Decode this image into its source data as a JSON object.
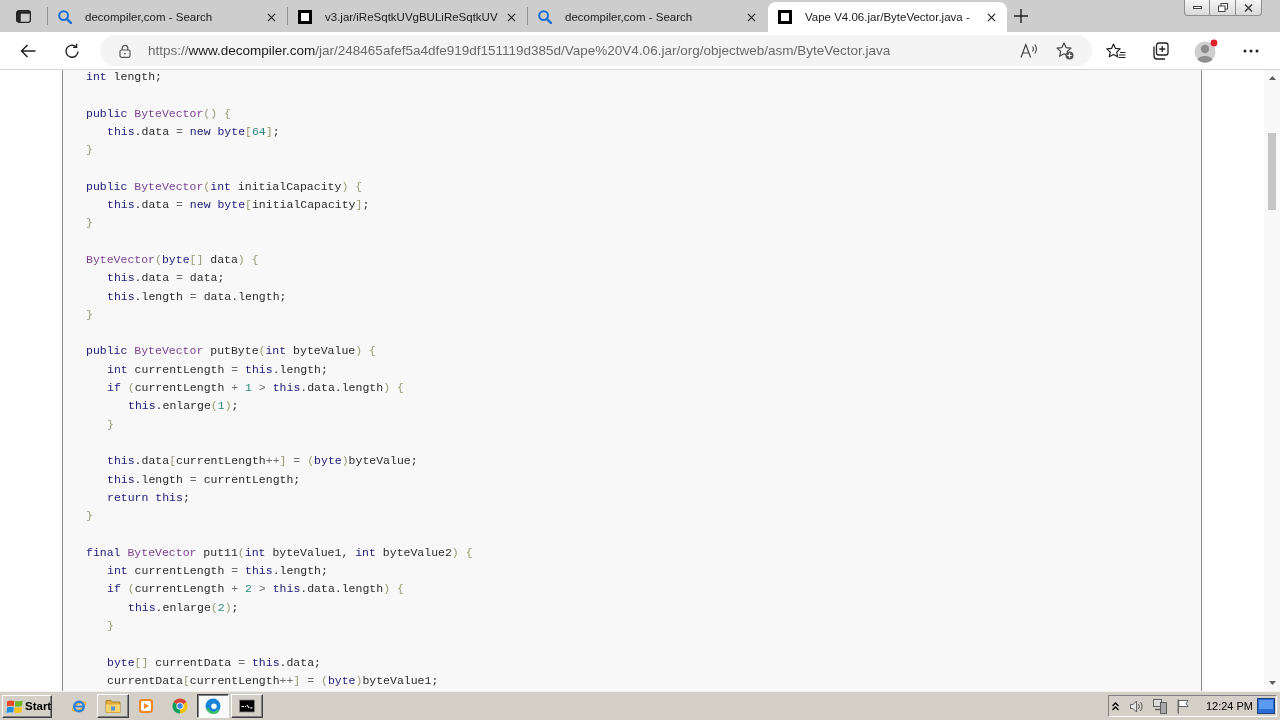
{
  "tabs": [
    {
      "title": "decompiler,com - Search",
      "kind": "search",
      "selected": false
    },
    {
      "title": "v3.jar/iReSqtkUVgBULiReSqtkUV",
      "kind": "page",
      "selected": false
    },
    {
      "title": "decompiler,com - Search",
      "kind": "search",
      "selected": false
    },
    {
      "title": "Vape V4.06.jar/ByteVector.java -",
      "kind": "page",
      "selected": true
    }
  ],
  "address_bar": {
    "scheme": "https://",
    "host": "www.decompiler.com",
    "path": "/jar/248465afef5a4dfe919df151119d385d/Vape%20V4.06.jar/org/objectweb/asm/ByteVector.java"
  },
  "code": {
    "lines": [
      {
        "kind": "code",
        "tokens": [
          {
            "kind": "keyword",
            "text": "int"
          },
          {
            "kind": "plain",
            "text": " length;"
          }
        ]
      },
      {
        "kind": "blank"
      },
      {
        "kind": "code",
        "tokens": [
          {
            "kind": "keyword",
            "text": "public "
          },
          {
            "kind": "type",
            "text": "ByteVector"
          },
          {
            "kind": "bracket",
            "text": "() {"
          }
        ],
        "children": [
          {
            "kind": "code",
            "tokens": [
              {
                "kind": "keyword",
                "text": "this"
              },
              {
                "kind": "plain",
                "text": ".data "
              },
              {
                "kind": "operator",
                "text": "="
              },
              {
                "kind": "keyword",
                "text": " new byte"
              },
              {
                "kind": "bracket",
                "text": "["
              },
              {
                "kind": "number",
                "text": "64"
              },
              {
                "kind": "bracket",
                "text": "]"
              },
              {
                "kind": "plain",
                "text": ";"
              }
            ]
          }
        ]
      },
      {
        "kind": "code",
        "tokens": [
          {
            "kind": "bracket",
            "text": "}"
          }
        ]
      },
      {
        "kind": "blank"
      },
      {
        "kind": "code",
        "tokens": [
          {
            "kind": "keyword",
            "text": "public "
          },
          {
            "kind": "type",
            "text": "ByteVector"
          },
          {
            "kind": "bracket",
            "text": "("
          },
          {
            "kind": "keyword",
            "text": "int"
          },
          {
            "kind": "plain",
            "text": " initialCapacity"
          },
          {
            "kind": "bracket",
            "text": ") {"
          }
        ],
        "children": [
          {
            "kind": "code",
            "tokens": [
              {
                "kind": "keyword",
                "text": "this"
              },
              {
                "kind": "plain",
                "text": ".data "
              },
              {
                "kind": "operator",
                "text": "="
              },
              {
                "kind": "keyword",
                "text": " new byte"
              },
              {
                "kind": "bracket",
                "text": "["
              },
              {
                "kind": "plain",
                "text": "initialCapacity"
              },
              {
                "kind": "bracket",
                "text": "]"
              },
              {
                "kind": "plain",
                "text": ";"
              }
            ]
          }
        ]
      },
      {
        "kind": "code",
        "tokens": [
          {
            "kind": "bracket",
            "text": "}"
          }
        ]
      },
      {
        "kind": "blank"
      },
      {
        "kind": "code",
        "tokens": [
          {
            "kind": "type",
            "text": "ByteVector"
          },
          {
            "kind": "bracket",
            "text": "("
          },
          {
            "kind": "keyword",
            "text": "byte"
          },
          {
            "kind": "bracket",
            "text": "[]"
          },
          {
            "kind": "plain",
            "text": " data"
          },
          {
            "kind": "bracket",
            "text": ") {"
          }
        ],
        "children": [
          {
            "kind": "code",
            "tokens": [
              {
                "kind": "keyword",
                "text": "this"
              },
              {
                "kind": "plain",
                "text": ".data "
              },
              {
                "kind": "operator",
                "text": "="
              },
              {
                "kind": "plain",
                "text": " data;"
              }
            ]
          },
          {
            "kind": "code",
            "tokens": [
              {
                "kind": "keyword",
                "text": "this"
              },
              {
                "kind": "plain",
                "text": ".length "
              },
              {
                "kind": "operator",
                "text": "="
              },
              {
                "kind": "plain",
                "text": " data.length;"
              }
            ]
          }
        ]
      },
      {
        "kind": "code",
        "tokens": [
          {
            "kind": "bracket",
            "text": "}"
          }
        ]
      },
      {
        "kind": "blank"
      },
      {
        "kind": "code",
        "tokens": [
          {
            "kind": "keyword",
            "text": "public "
          },
          {
            "kind": "type",
            "text": "ByteVector"
          },
          {
            "kind": "plain",
            "text": " putByte"
          },
          {
            "kind": "bracket",
            "text": "("
          },
          {
            "kind": "keyword",
            "text": "int"
          },
          {
            "kind": "plain",
            "text": " byteValue"
          },
          {
            "kind": "bracket",
            "text": ") {"
          }
        ],
        "children": [
          {
            "kind": "code",
            "tokens": [
              {
                "kind": "keyword",
                "text": "int"
              },
              {
                "kind": "plain",
                "text": " currentLength "
              },
              {
                "kind": "operator",
                "text": "="
              },
              {
                "kind": "keyword",
                "text": " this"
              },
              {
                "kind": "plain",
                "text": ".length;"
              }
            ]
          },
          {
            "kind": "code",
            "tokens": [
              {
                "kind": "keyword",
                "text": "if "
              },
              {
                "kind": "bracket",
                "text": "("
              },
              {
                "kind": "plain",
                "text": "currentLength "
              },
              {
                "kind": "operator",
                "text": "+"
              },
              {
                "kind": "number",
                "text": " 1"
              },
              {
                "kind": "operator",
                "text": " >"
              },
              {
                "kind": "keyword",
                "text": " this"
              },
              {
                "kind": "plain",
                "text": ".data.length"
              },
              {
                "kind": "bracket",
                "text": ") {"
              }
            ],
            "children": [
              {
                "kind": "code",
                "tokens": [
                  {
                    "kind": "keyword",
                    "text": "this"
                  },
                  {
                    "kind": "plain",
                    "text": ".enlarge"
                  },
                  {
                    "kind": "bracket",
                    "text": "("
                  },
                  {
                    "kind": "number",
                    "text": "1"
                  },
                  {
                    "kind": "bracket",
                    "text": ")"
                  },
                  {
                    "kind": "plain",
                    "text": ";"
                  }
                ]
              }
            ]
          },
          {
            "kind": "code",
            "tokens": [
              {
                "kind": "bracket",
                "text": "}"
              }
            ]
          },
          {
            "kind": "blank"
          },
          {
            "kind": "code",
            "tokens": [
              {
                "kind": "keyword",
                "text": "this"
              },
              {
                "kind": "plain",
                "text": ".data"
              },
              {
                "kind": "bracket",
                "text": "["
              },
              {
                "kind": "plain",
                "text": "currentLength"
              },
              {
                "kind": "operator",
                "text": "++"
              },
              {
                "kind": "bracket",
                "text": "]"
              },
              {
                "kind": "operator",
                "text": " ="
              },
              {
                "kind": "bracket",
                "text": " ("
              },
              {
                "kind": "keyword",
                "text": "byte"
              },
              {
                "kind": "bracket",
                "text": ")"
              },
              {
                "kind": "plain",
                "text": "byteValue;"
              }
            ]
          },
          {
            "kind": "code",
            "tokens": [
              {
                "kind": "keyword",
                "text": "this"
              },
              {
                "kind": "plain",
                "text": ".length "
              },
              {
                "kind": "operator",
                "text": "="
              },
              {
                "kind": "plain",
                "text": " currentLength;"
              }
            ]
          },
          {
            "kind": "code",
            "tokens": [
              {
                "kind": "keyword",
                "text": "return this"
              },
              {
                "kind": "plain",
                "text": ";"
              }
            ]
          }
        ]
      },
      {
        "kind": "code",
        "tokens": [
          {
            "kind": "bracket",
            "text": "}"
          }
        ]
      },
      {
        "kind": "blank"
      },
      {
        "kind": "code",
        "tokens": [
          {
            "kind": "keyword",
            "text": "final "
          },
          {
            "kind": "type",
            "text": "ByteVector"
          },
          {
            "kind": "plain",
            "text": " put11"
          },
          {
            "kind": "bracket",
            "text": "("
          },
          {
            "kind": "keyword",
            "text": "int"
          },
          {
            "kind": "plain",
            "text": " byteValue1, "
          },
          {
            "kind": "keyword",
            "text": "int"
          },
          {
            "kind": "plain",
            "text": " byteValue2"
          },
          {
            "kind": "bracket",
            "text": ") {"
          }
        ],
        "children": [
          {
            "kind": "code",
            "tokens": [
              {
                "kind": "keyword",
                "text": "int"
              },
              {
                "kind": "plain",
                "text": " currentLength "
              },
              {
                "kind": "operator",
                "text": "="
              },
              {
                "kind": "keyword",
                "text": " this"
              },
              {
                "kind": "plain",
                "text": ".length;"
              }
            ]
          },
          {
            "kind": "code",
            "tokens": [
              {
                "kind": "keyword",
                "text": "if "
              },
              {
                "kind": "bracket",
                "text": "("
              },
              {
                "kind": "plain",
                "text": "currentLength "
              },
              {
                "kind": "operator",
                "text": "+"
              },
              {
                "kind": "number",
                "text": " 2"
              },
              {
                "kind": "operator",
                "text": " >"
              },
              {
                "kind": "keyword",
                "text": " this"
              },
              {
                "kind": "plain",
                "text": ".data.length"
              },
              {
                "kind": "bracket",
                "text": ") {"
              }
            ],
            "children": [
              {
                "kind": "code",
                "tokens": [
                  {
                    "kind": "keyword",
                    "text": "this"
                  },
                  {
                    "kind": "plain",
                    "text": ".enlarge"
                  },
                  {
                    "kind": "bracket",
                    "text": "("
                  },
                  {
                    "kind": "number",
                    "text": "2"
                  },
                  {
                    "kind": "bracket",
                    "text": ")"
                  },
                  {
                    "kind": "plain",
                    "text": ";"
                  }
                ]
              }
            ]
          },
          {
            "kind": "code",
            "tokens": [
              {
                "kind": "bracket",
                "text": "}"
              }
            ]
          },
          {
            "kind": "blank"
          },
          {
            "kind": "code",
            "tokens": [
              {
                "kind": "keyword",
                "text": "byte"
              },
              {
                "kind": "bracket",
                "text": "[]"
              },
              {
                "kind": "plain",
                "text": " currentData "
              },
              {
                "kind": "operator",
                "text": "="
              },
              {
                "kind": "keyword",
                "text": " this"
              },
              {
                "kind": "plain",
                "text": ".data;"
              }
            ]
          },
          {
            "kind": "code",
            "tokens": [
              {
                "kind": "plain",
                "text": "currentData"
              },
              {
                "kind": "bracket",
                "text": "["
              },
              {
                "kind": "plain",
                "text": "currentLength"
              },
              {
                "kind": "operator",
                "text": "++"
              },
              {
                "kind": "bracket",
                "text": "]"
              },
              {
                "kind": "operator",
                "text": " ="
              },
              {
                "kind": "bracket",
                "text": " ("
              },
              {
                "kind": "keyword",
                "text": "byte"
              },
              {
                "kind": "bracket",
                "text": ")"
              },
              {
                "kind": "plain",
                "text": "byteValue1;"
              }
            ]
          }
        ]
      }
    ]
  },
  "taskbar": {
    "start_label": "Start",
    "apps": [
      {
        "kind": "ie",
        "running": false,
        "selected": false
      },
      {
        "kind": "folder",
        "running": true,
        "selected": false
      },
      {
        "kind": "media",
        "running": false,
        "selected": false
      },
      {
        "kind": "chrome",
        "running": false,
        "selected": false
      },
      {
        "kind": "edge",
        "running": true,
        "selected": true
      },
      {
        "kind": "terminal",
        "running": true,
        "selected": false
      }
    ],
    "clock": "12:24 PM"
  }
}
